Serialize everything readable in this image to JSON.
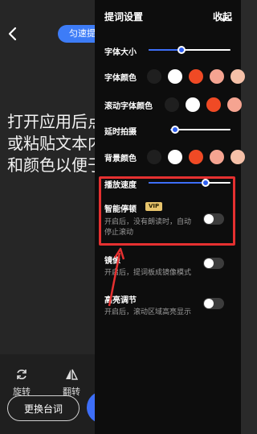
{
  "background": {
    "pill_label": "匀速提",
    "body_text_lines": [
      "打开应用后点",
      "或粘贴文本内",
      "和颜色以便于"
    ],
    "tools": [
      {
        "label": "旋转",
        "icon": "rotate-icon"
      },
      {
        "label": "翻转",
        "icon": "flip-icon"
      }
    ],
    "change_button": "更换台词"
  },
  "panel": {
    "title": "提词设置",
    "collapse_label": "收起",
    "font_size": {
      "label": "字体大小",
      "value_pct": 40
    },
    "font_color": {
      "label": "字体颜色",
      "swatches": [
        "#1f1f1f",
        "#ffffff",
        "#f04a25",
        "#f5a491",
        "#f5c0a8"
      ]
    },
    "scroll_color": {
      "label": "滚动字体颜色",
      "swatches": [
        "#1f1f1f",
        "#ffffff",
        "#f04a25",
        "#f5a491"
      ]
    },
    "delay": {
      "label": "延时拍摄",
      "value_pct": 8
    },
    "bg_color": {
      "label": "背景颜色",
      "swatches": [
        "#1f1f1f",
        "#ffffff",
        "#f04a25",
        "#f5a491",
        "#f5c0a8"
      ]
    },
    "speed": {
      "label": "播放速度",
      "value_pct": 70
    },
    "smart_pause": {
      "label": "智能停顿",
      "badge": "VIP",
      "desc": [
        "开启后，没有朗读时，自动",
        "停止滚动"
      ],
      "on": false
    },
    "mirror": {
      "label": "镜像",
      "desc": "开启后，提词板成镜像模式",
      "on": false
    },
    "highlight": {
      "label": "高亮调节",
      "desc": "开启后，滚动区域高亮显示",
      "on": false
    }
  },
  "colors": {
    "accent": "#3d6ef7",
    "highlight_box": "#e53030",
    "vip": "#e7c46c"
  }
}
